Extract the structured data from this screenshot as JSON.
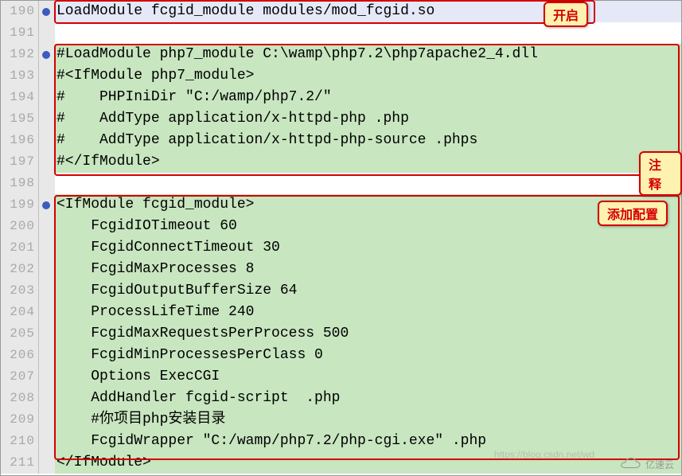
{
  "callouts": {
    "enable": "开启",
    "comment": "注释",
    "add_config": "添加配置"
  },
  "watermark": {
    "main": "亿速云",
    "secondary": "https://blog.csdn.net/wd"
  },
  "lines": [
    {
      "num": "190",
      "dot": true,
      "bg": "blue",
      "text": "LoadModule fcgid_module modules/mod_fcgid.so"
    },
    {
      "num": "191",
      "dot": false,
      "bg": "white",
      "text": ""
    },
    {
      "num": "192",
      "dot": true,
      "bg": "green",
      "text": "#LoadModule php7_module C:\\wamp\\php7.2\\php7apache2_4.dll"
    },
    {
      "num": "193",
      "dot": false,
      "bg": "green",
      "text": "#<IfModule php7_module>"
    },
    {
      "num": "194",
      "dot": false,
      "bg": "green",
      "text": "#    PHPIniDir \"C:/wamp/php7.2/\""
    },
    {
      "num": "195",
      "dot": false,
      "bg": "green",
      "text": "#    AddType application/x-httpd-php .php"
    },
    {
      "num": "196",
      "dot": false,
      "bg": "green",
      "text": "#    AddType application/x-httpd-php-source .phps"
    },
    {
      "num": "197",
      "dot": false,
      "bg": "green",
      "text": "#</IfModule>"
    },
    {
      "num": "198",
      "dot": false,
      "bg": "white",
      "text": ""
    },
    {
      "num": "199",
      "dot": true,
      "bg": "green",
      "text": "<IfModule fcgid_module>"
    },
    {
      "num": "200",
      "dot": false,
      "bg": "green",
      "text": "    FcgidIOTimeout 60"
    },
    {
      "num": "201",
      "dot": false,
      "bg": "green",
      "text": "    FcgidConnectTimeout 30"
    },
    {
      "num": "202",
      "dot": false,
      "bg": "green",
      "text": "    FcgidMaxProcesses 8"
    },
    {
      "num": "203",
      "dot": false,
      "bg": "green",
      "text": "    FcgidOutputBufferSize 64"
    },
    {
      "num": "204",
      "dot": false,
      "bg": "green",
      "text": "    ProcessLifeTime 240"
    },
    {
      "num": "205",
      "dot": false,
      "bg": "green",
      "text": "    FcgidMaxRequestsPerProcess 500"
    },
    {
      "num": "206",
      "dot": false,
      "bg": "green",
      "text": "    FcgidMinProcessesPerClass 0"
    },
    {
      "num": "207",
      "dot": false,
      "bg": "green",
      "text": "    Options ExecCGI"
    },
    {
      "num": "208",
      "dot": false,
      "bg": "green",
      "text": "    AddHandler fcgid-script  .php"
    },
    {
      "num": "209",
      "dot": false,
      "bg": "green",
      "text": "    #你项目php安装目录"
    },
    {
      "num": "210",
      "dot": false,
      "bg": "green",
      "text": "    FcgidWrapper \"C:/wamp/php7.2/php-cgi.exe\" .php"
    },
    {
      "num": "211",
      "dot": false,
      "bg": "green",
      "text": "</IfModule>"
    }
  ]
}
